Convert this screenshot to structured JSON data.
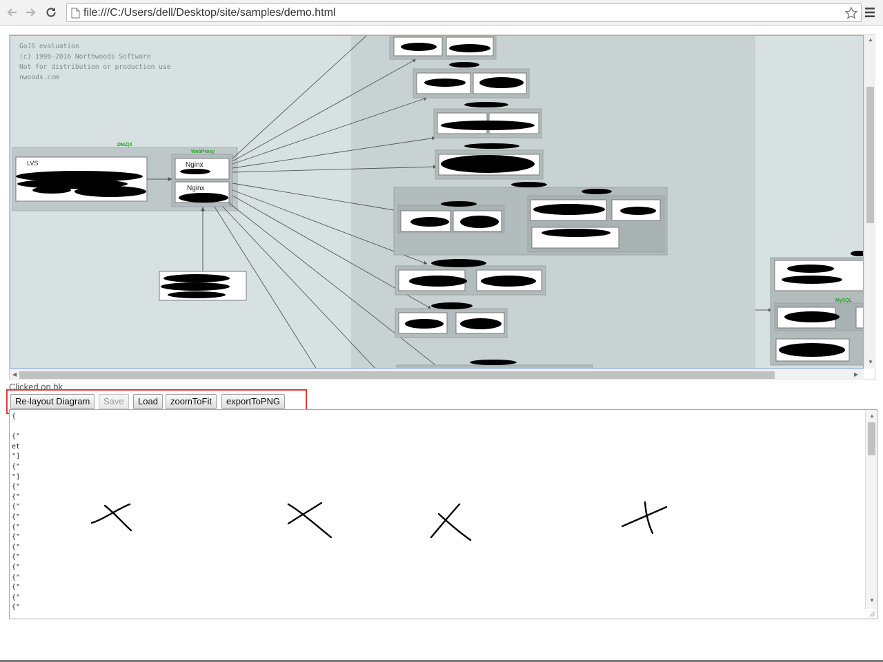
{
  "browser": {
    "url": "file:///C:/Users/dell/Desktop/site/samples/demo.html"
  },
  "diagram": {
    "watermark": [
      "GoJS evaluation",
      "(c) 1998-2016 Northwoods Software",
      "Not for distribution or production use",
      "nwoods.com"
    ],
    "groups": {
      "dmz": "DMZ|X",
      "webproxy": "WebProxy",
      "mysql": "MySQL"
    },
    "nodes": {
      "nginx_1": "Nginx",
      "nginx_2": "Nginx",
      "lvs_top": "LVS"
    }
  },
  "status": {
    "clicked": "Clicked on bk"
  },
  "buttons": {
    "relayout": "Re-layout Diagram",
    "save": "Save",
    "load": "Load",
    "zoom": "zoomToFit",
    "export": "exportToPNG"
  },
  "textarea": {
    "lines": [
      "{",
      "",
      "{\"",
      "et",
      "\"]",
      "{\"",
      "\"]",
      "{\"",
      "{\"",
      "{\"",
      "{\"",
      "{\"",
      "{\"",
      "{\"",
      "{\"",
      "{\"",
      "{\"",
      "{\"",
      "{\"",
      "{\""
    ]
  }
}
